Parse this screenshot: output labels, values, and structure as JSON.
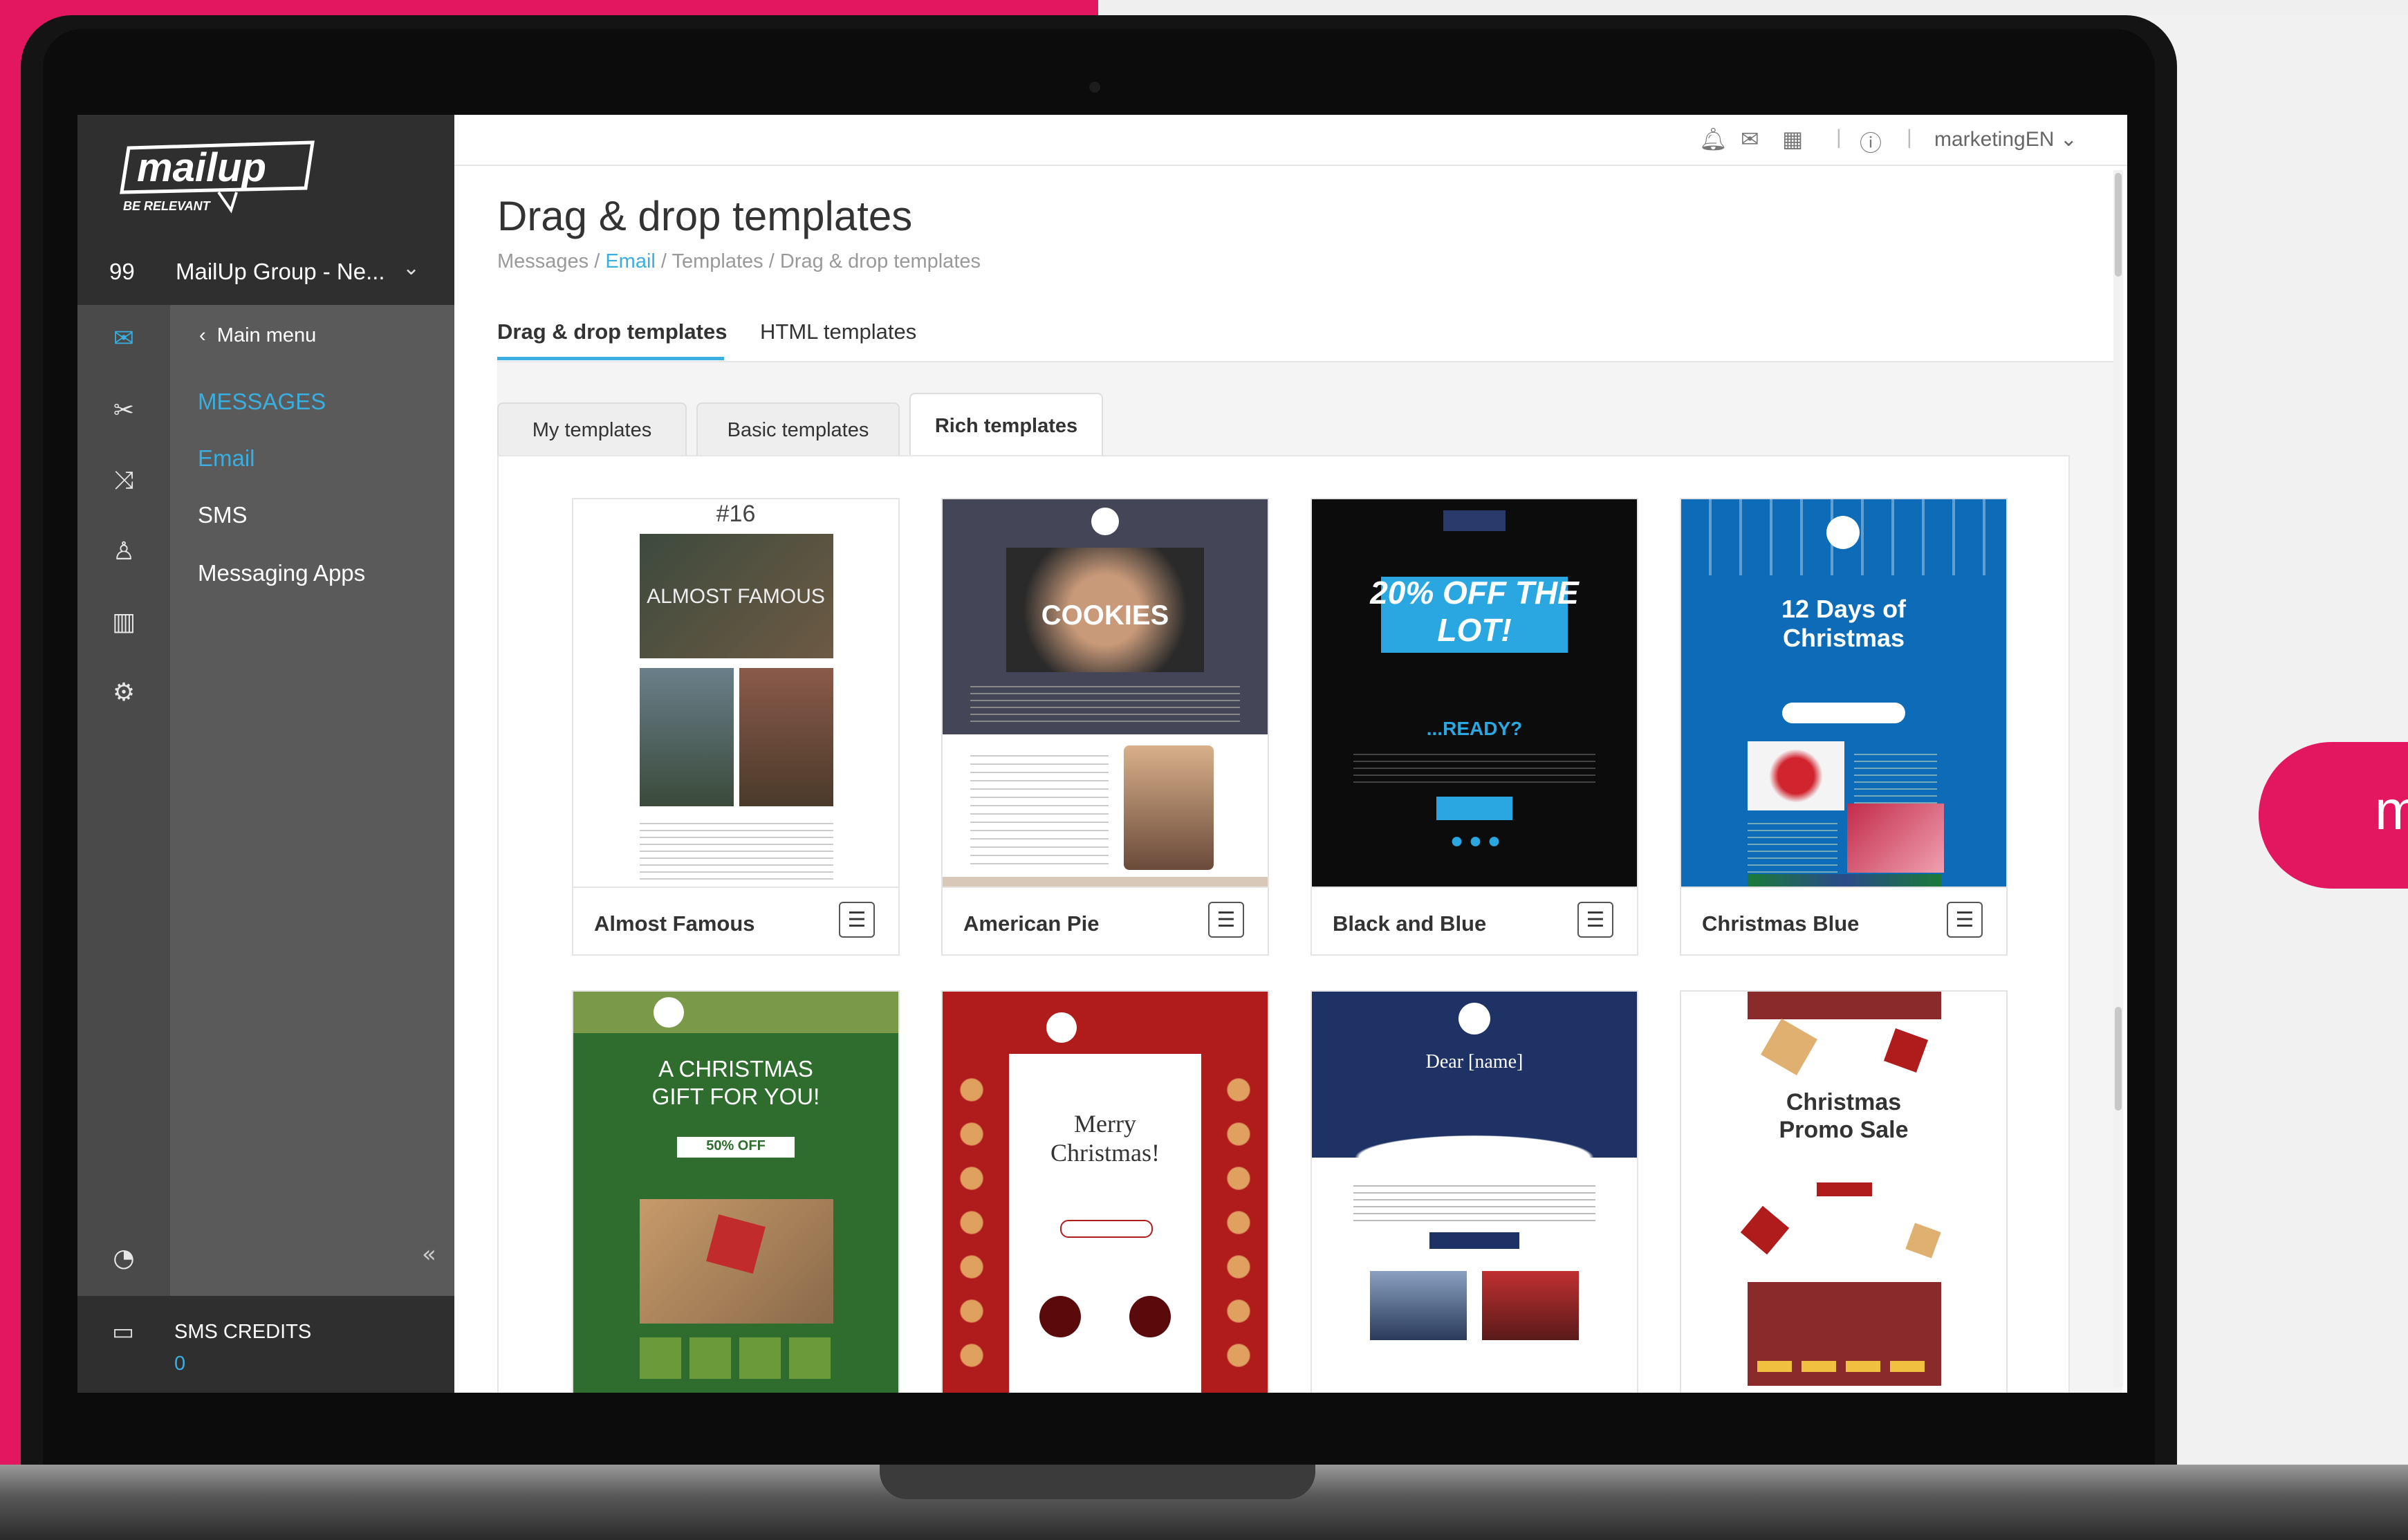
{
  "brand": {
    "logo": "mailup",
    "tagline": "BE RELEVANT",
    "pill_text": "m"
  },
  "account": {
    "number": "99",
    "name": "MailUp Group - Ne...",
    "chevron": "chevron-down-icon"
  },
  "rail": {
    "icons": [
      "mail-icon",
      "tools-icon",
      "shuffle-icon",
      "person-icon",
      "chart-icon",
      "gear-icon",
      "gauge-icon"
    ]
  },
  "sidebar": {
    "main_menu": "Main menu",
    "items": [
      {
        "label": "MESSAGES"
      },
      {
        "label": "Email"
      },
      {
        "label": "SMS"
      },
      {
        "label": "Messaging Apps"
      }
    ],
    "collapse": "«"
  },
  "sms": {
    "label": "SMS CREDITS",
    "value": "0"
  },
  "topbar": {
    "icons": [
      "bell-icon",
      "mail-send-icon",
      "calendar-icon",
      "help-icon"
    ],
    "user": "marketingEN"
  },
  "page": {
    "title": "Drag & drop templates"
  },
  "breadcrumb": {
    "messages": "Messages",
    "sep1": " / ",
    "email": "Email",
    "sep2": " / ",
    "templates": "Templates",
    "sep3": " / ",
    "current": "Drag & drop templates"
  },
  "tabs": {
    "dnd": "Drag & drop templates",
    "html": "HTML templates"
  },
  "subtabs": {
    "my": "My templates",
    "basic": "Basic templates",
    "rich": "Rich templates"
  },
  "templates": [
    {
      "name": "Almost Famous",
      "thumb_title": "#16",
      "thumb_text": "ALMOST FAMOUS"
    },
    {
      "name": "American Pie",
      "thumb_text": "COOKIES"
    },
    {
      "name": "Black and Blue",
      "thumb_text": "20% OFF THE LOT!",
      "thumb_sub": "...READY?"
    },
    {
      "name": "Christmas Blue",
      "thumb_text": "12 Days of Christmas"
    },
    {
      "thumb_text": "A CHRISTMAS GIFT FOR YOU!",
      "thumb_sub": "50% OFF"
    },
    {
      "thumb_text": "Merry Christmas!"
    },
    {
      "thumb_text": "Dear [name]"
    },
    {
      "thumb_text": "Christmas Promo Sale"
    }
  ],
  "colors": {
    "accent": "#3aaee0",
    "brand_pink": "#e2175f",
    "sidebar": "#5a5a5a",
    "rail": "#4a4a4a"
  }
}
